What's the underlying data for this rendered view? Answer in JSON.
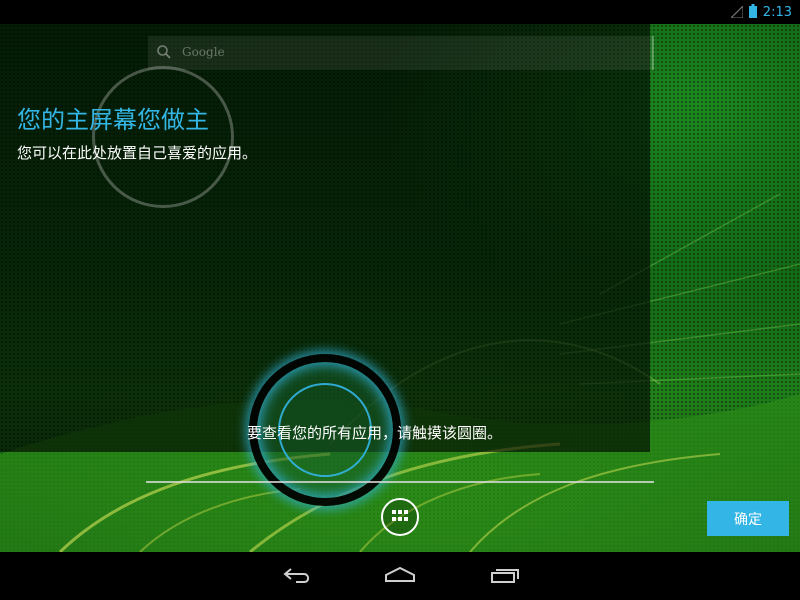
{
  "status_bar": {
    "time": "2:13",
    "icons": [
      "signal-icon",
      "battery-icon"
    ]
  },
  "home": {
    "search_label": "Google",
    "cling": {
      "title": "您的主屏幕您做主",
      "body": "您可以在此处放置自己喜爱的应用。",
      "hint": "要查看您的所有应用，请触摸该圆圈。",
      "ok_button": "确定"
    }
  },
  "nav_bar": {
    "buttons": [
      "back-icon",
      "home-icon",
      "recents-icon"
    ]
  },
  "colors": {
    "accent": "#33b5e5",
    "wallpaper": "#1f7f1a"
  }
}
